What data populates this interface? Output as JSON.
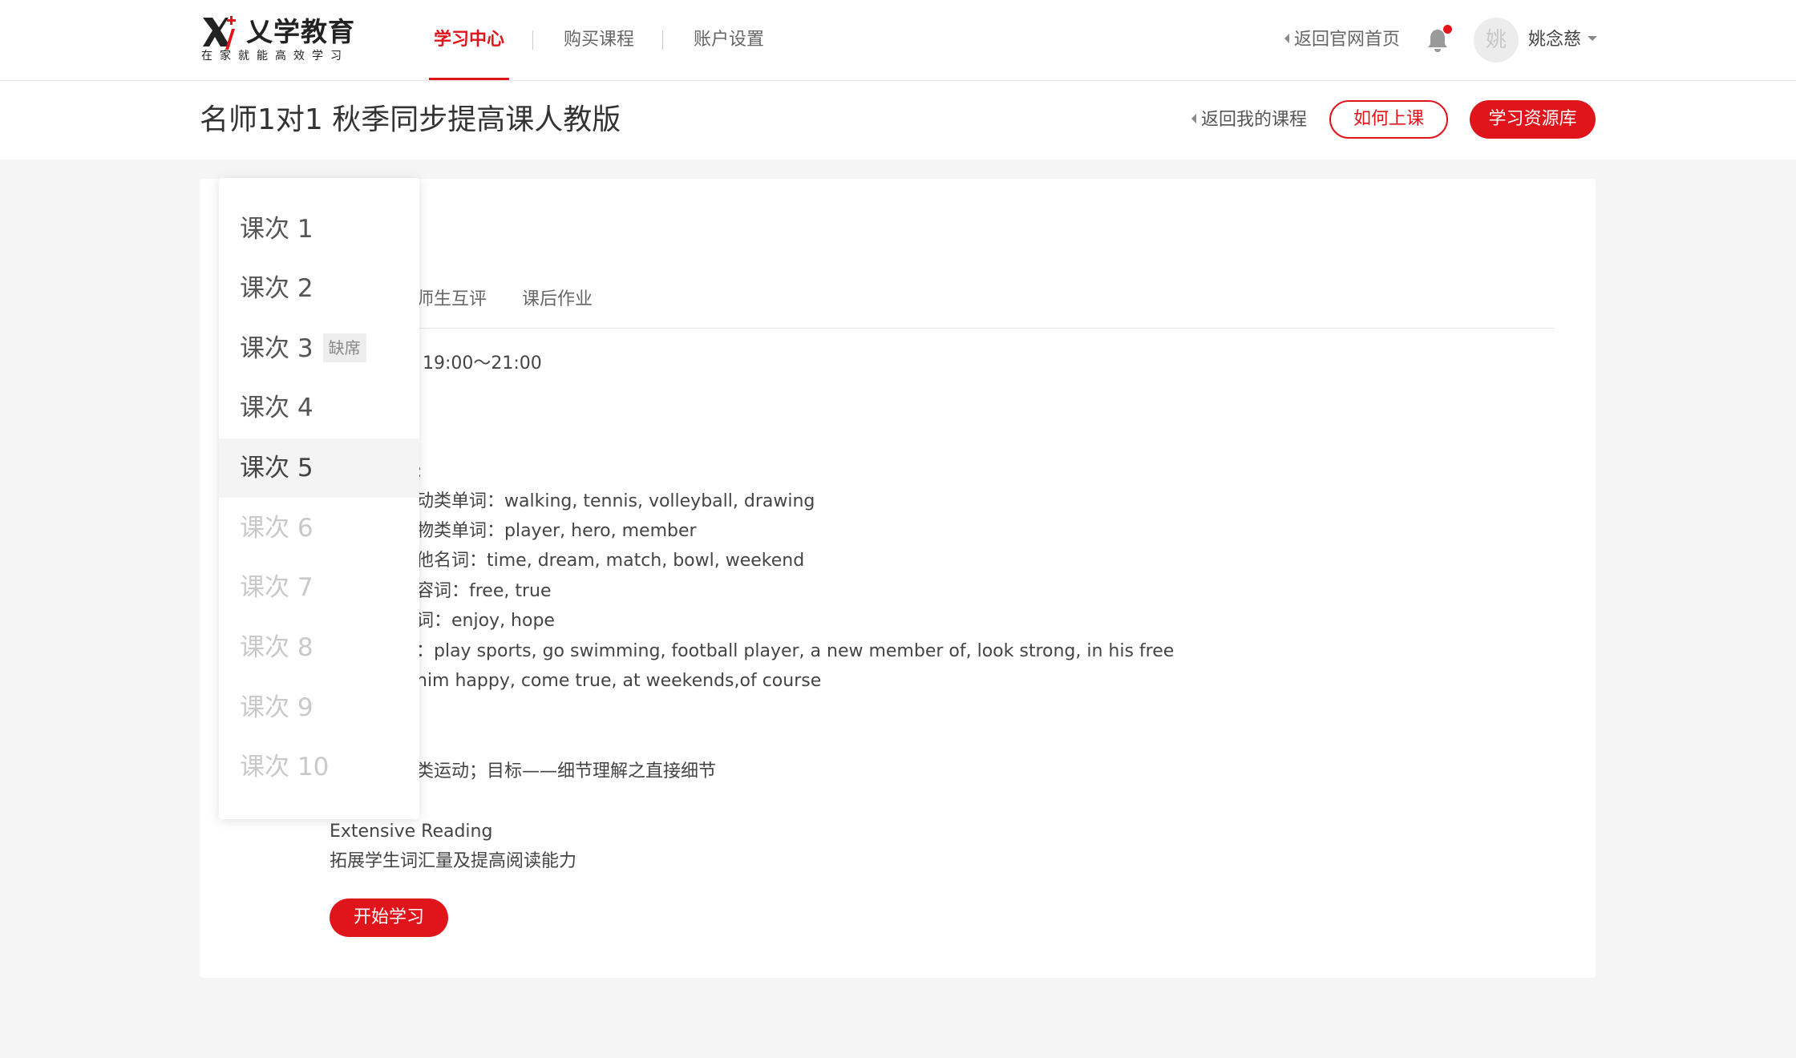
{
  "header": {
    "brand": "乂学教育",
    "slogan": "在家就能高效学习",
    "nav": [
      {
        "label": "学习中心",
        "active": true
      },
      {
        "label": "购买课程",
        "active": false
      },
      {
        "label": "账户设置",
        "active": false
      }
    ],
    "back_home": "返回官网首页",
    "avatar_char": "姚",
    "username": "姚念慈",
    "notification_dot_color": "#e0151b"
  },
  "course": {
    "title": "名师1对1 秋季同步提高课人教版",
    "back_label": "返回我的课程",
    "how_label": "如何上课",
    "library_label": "学习资源库"
  },
  "tabs": [
    "师生互评",
    "课后作业"
  ],
  "content": {
    "time": "19:00～21:00",
    "colon": ":",
    "vocab_lines": [
      "动类单词：walking, tennis, volleyball, drawing",
      "物类单词：player, hero, member",
      "他名词：time, dream, match, bowl, weekend",
      "容词：free, true",
      "词：enjoy, hope",
      "：play sports, go swimming, football player, a new member of, look strong, in his free",
      "him happy, come true, at weekends,of course"
    ],
    "reading_line": "类运动；目标——细节理解之直接细节",
    "extensive_title": "Extensive Reading",
    "extensive_desc": "拓展学生词汇量及提高阅读能力",
    "start_label": "开始学习"
  },
  "lessons": [
    {
      "label": "课次 1",
      "state": "normal"
    },
    {
      "label": "课次 2",
      "state": "normal"
    },
    {
      "label": "课次 3",
      "state": "normal",
      "badge": "缺席"
    },
    {
      "label": "课次 4",
      "state": "normal"
    },
    {
      "label": "课次 5",
      "state": "selected"
    },
    {
      "label": "课次 6",
      "state": "disabled"
    },
    {
      "label": "课次 7",
      "state": "disabled"
    },
    {
      "label": "课次 8",
      "state": "disabled"
    },
    {
      "label": "课次 9",
      "state": "disabled"
    },
    {
      "label": "课次 10",
      "state": "disabled"
    }
  ],
  "colors": {
    "accent": "#e0151b",
    "background": "#f5f5f5",
    "disabled_text": "#c9c9c9"
  }
}
